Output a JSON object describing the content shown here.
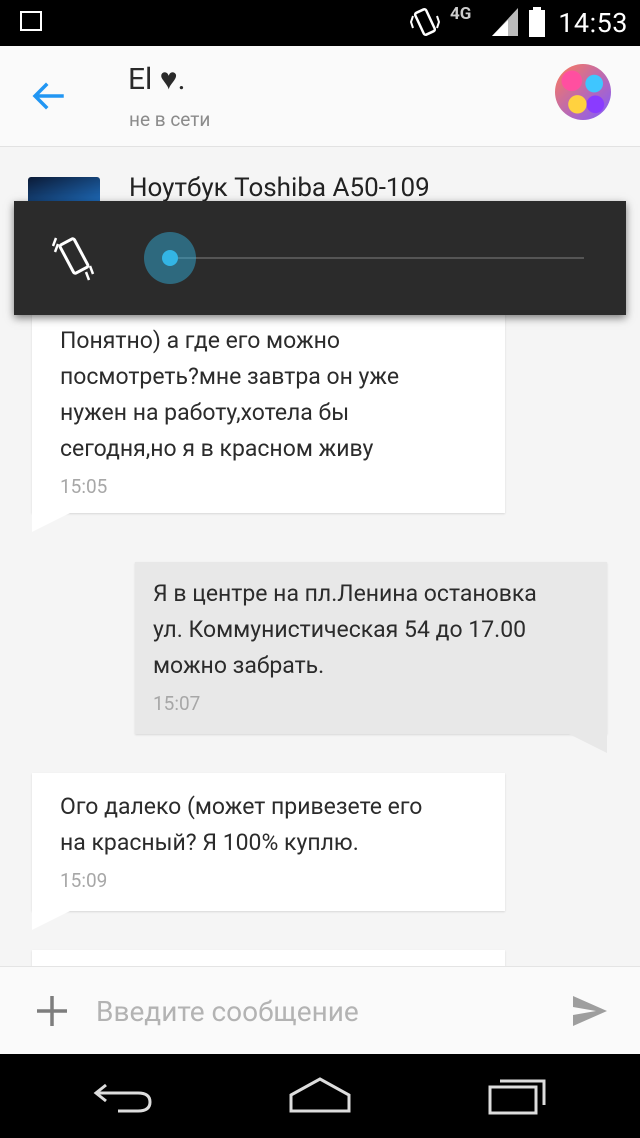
{
  "status_bar": {
    "time": "14:53",
    "network": "4G",
    "icons": [
      "gallery-icon",
      "vibrate-icon",
      "signal-icon",
      "battery-icon"
    ]
  },
  "app_bar": {
    "contact_name": "El ♥.",
    "contact_status": "не в сети",
    "icons": [
      "back-arrow-icon",
      "avatar"
    ]
  },
  "item": {
    "title": "Ноутбук Toshiba A50-109"
  },
  "volume_popup": {
    "mode_icon": "vibrate-icon",
    "level": 0
  },
  "messages": [
    {
      "direction": "incoming",
      "text": "Понятно) а где его можно\nпосмотреть?мне завтра он уже\nнужен на работу,хотела бы\nсегодня,но я в красном живу",
      "time": "15:05"
    },
    {
      "direction": "outgoing",
      "text": "Я в центре на пл.Ленина остановка\nул. Коммунистическая 54 до 17.00\nможно забрать.",
      "time": "15:07"
    },
    {
      "direction": "incoming",
      "text": "Ого далеко (может привезете его\nна красный? Я 100% куплю.",
      "time": "15:09"
    }
  ],
  "input_bar": {
    "placeholder": "Введите сообщение",
    "value": "",
    "icons": [
      "plus-icon",
      "send-icon"
    ]
  },
  "nav_bar": {
    "icons": [
      "nav-back-icon",
      "nav-home-icon",
      "nav-recents-icon"
    ]
  },
  "colors": {
    "accent": "#2196f3",
    "volume_accent": "#33b5e5",
    "incoming_bubble": "#ffffff",
    "outgoing_bubble": "#e8e8e8"
  }
}
